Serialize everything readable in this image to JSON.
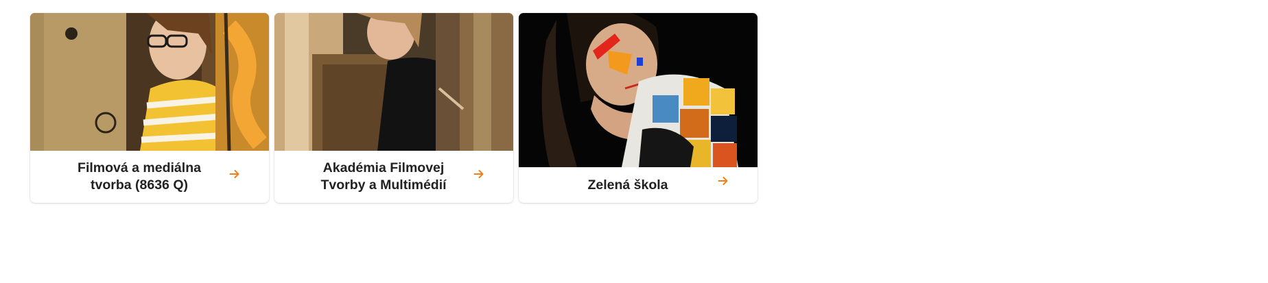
{
  "colors": {
    "accent": "#f07f1b",
    "title_text": "#222222",
    "card_background": "#ffffff"
  },
  "cards": [
    {
      "title": "Filmová a mediálna tvorba (8636 Q)",
      "image_alt": "Student with glasses painting at an easel in an art studio",
      "arrow_icon": "arrow-right-icon"
    },
    {
      "title": "Akadémia Filmovej Tvorby a Multimédií",
      "image_alt": "Student painting at wooden easels in an art studio",
      "arrow_icon": "arrow-right-icon"
    },
    {
      "title": "Zelená škola",
      "image_alt": "Girl with colorful face paint wearing a patchwork vest on black background",
      "arrow_icon": "arrow-right-icon"
    }
  ]
}
